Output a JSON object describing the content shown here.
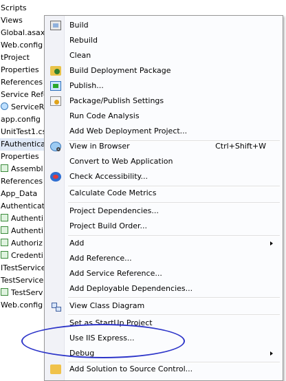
{
  "tree": {
    "items": [
      {
        "label": "Scripts",
        "icon": ""
      },
      {
        "label": "Views",
        "icon": ""
      },
      {
        "label": "Global.asax",
        "icon": ""
      },
      {
        "label": "Web.config",
        "icon": ""
      },
      {
        "label": "tProject",
        "icon": ""
      },
      {
        "label": "Properties",
        "icon": ""
      },
      {
        "label": "References",
        "icon": ""
      },
      {
        "label": "Service Refe",
        "icon": ""
      },
      {
        "label": "ServiceR",
        "icon": "globe-icon"
      },
      {
        "label": "app.config",
        "icon": ""
      },
      {
        "label": "UnitTest1.cs",
        "icon": ""
      },
      {
        "label": "FAuthentica",
        "icon": "",
        "selected": true
      },
      {
        "label": "Properties",
        "icon": ""
      },
      {
        "label": "Assembl",
        "icon": "code-file-icon"
      },
      {
        "label": "References",
        "icon": ""
      },
      {
        "label": "App_Data",
        "icon": ""
      },
      {
        "label": "Authenticatio",
        "icon": ""
      },
      {
        "label": "Authenti",
        "icon": "code-file-icon"
      },
      {
        "label": "Authenti",
        "icon": "code-file-icon"
      },
      {
        "label": "Authoriz",
        "icon": "code-file-icon"
      },
      {
        "label": "Credenti",
        "icon": "code-file-icon"
      },
      {
        "label": "ITestService.",
        "icon": ""
      },
      {
        "label": "TestService.s",
        "icon": ""
      },
      {
        "label": "TestServ",
        "icon": "code-file-icon"
      },
      {
        "label": "Web.config",
        "icon": ""
      }
    ]
  },
  "menu": {
    "build": {
      "label": "Build",
      "icon": "build-icon"
    },
    "rebuild": {
      "label": "Rebuild"
    },
    "clean": {
      "label": "Clean"
    },
    "build_deploy": {
      "label": "Build Deployment Package",
      "icon": "deployment-package-icon"
    },
    "publish": {
      "label": "Publish...",
      "icon": "publish-icon"
    },
    "pkg_settings": {
      "label": "Package/Publish Settings",
      "icon": "settings-icon"
    },
    "code_analysis": {
      "label": "Run Code Analysis"
    },
    "add_web_deploy": {
      "label": "Add Web Deployment Project..."
    },
    "view_browser": {
      "label": "View in Browser",
      "shortcut": "Ctrl+Shift+W",
      "icon": "browser-icon"
    },
    "convert": {
      "label": "Convert to Web Application"
    },
    "check_access": {
      "label": "Check Accessibility...",
      "icon": "accessibility-icon"
    },
    "code_metrics": {
      "label": "Calculate Code Metrics"
    },
    "proj_deps": {
      "label": "Project Dependencies..."
    },
    "build_order": {
      "label": "Project Build Order..."
    },
    "add": {
      "label": "Add"
    },
    "add_ref": {
      "label": "Add Reference..."
    },
    "add_service_ref": {
      "label": "Add Service Reference..."
    },
    "add_deployable": {
      "label": "Add Deployable Dependencies..."
    },
    "class_diagram": {
      "label": "View Class Diagram",
      "icon": "class-diagram-icon"
    },
    "startup": {
      "label": "Set as StartUp Project"
    },
    "iis_express": {
      "label": "Use IIS Express..."
    },
    "debug": {
      "label": "Debug"
    },
    "source_control": {
      "label": "Add Solution to Source Control...",
      "icon": "source-control-icon"
    }
  },
  "annotation": {
    "color": "#2d35c9"
  }
}
